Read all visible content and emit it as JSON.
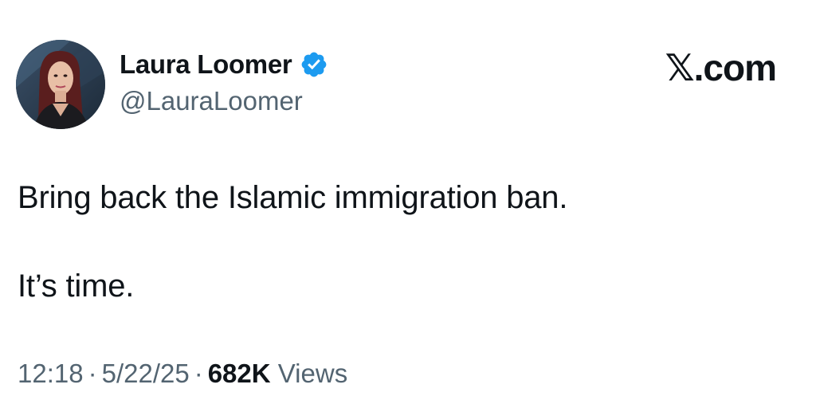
{
  "author": {
    "display_name": "Laura Loomer",
    "handle": "@LauraLoomer",
    "verified_icon": "verified-badge-icon",
    "avatar": "profile-photo"
  },
  "brand": {
    "label": "𝕏.com"
  },
  "tweet": {
    "lines": [
      "Bring back the Islamic immigration ban.",
      "It’s time."
    ]
  },
  "meta": {
    "time": "12:18",
    "separator": "·",
    "date": "5/22/25",
    "views_count": "682K",
    "views_label": "Views"
  },
  "colors": {
    "text_primary": "#0f1419",
    "text_secondary": "#536471",
    "verified_blue": "#1d9bf0"
  }
}
